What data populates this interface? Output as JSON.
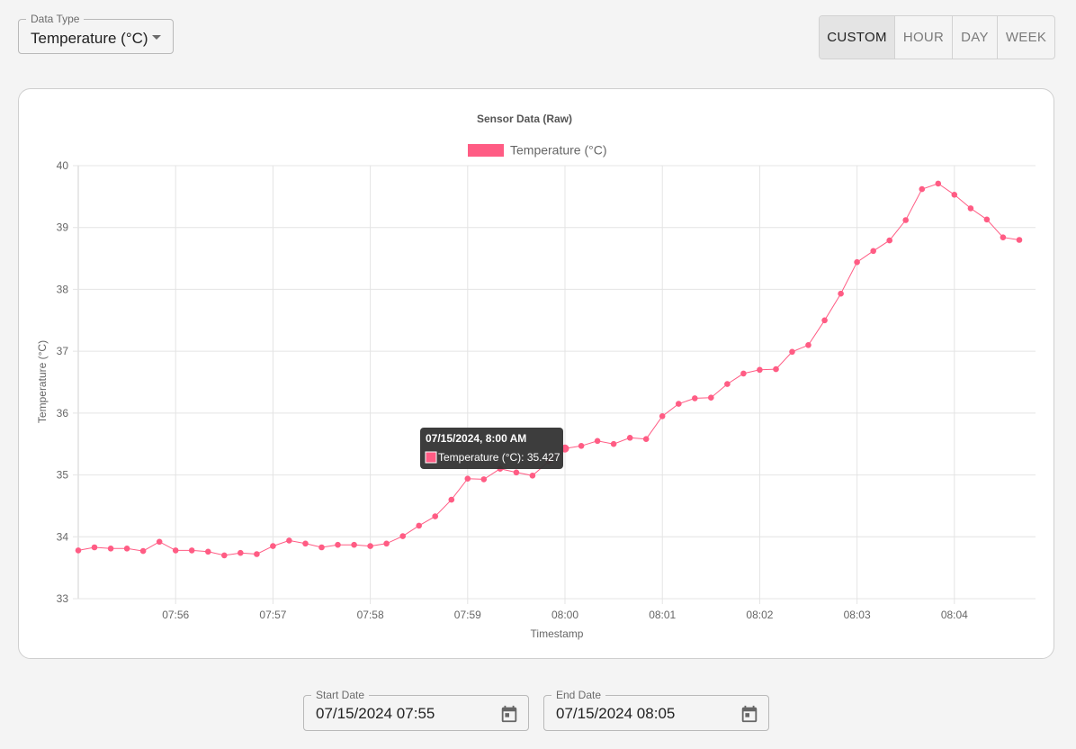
{
  "controls": {
    "data_type": {
      "label": "Data Type",
      "value": "Temperature (°C)"
    },
    "range_buttons": [
      {
        "label": "CUSTOM",
        "selected": true
      },
      {
        "label": "HOUR",
        "selected": false
      },
      {
        "label": "DAY",
        "selected": false
      },
      {
        "label": "WEEK",
        "selected": false
      }
    ],
    "start_date": {
      "label": "Start Date",
      "value": "07/15/2024 07:55"
    },
    "end_date": {
      "label": "End Date",
      "value": "07/15/2024 08:05"
    }
  },
  "colors": {
    "series": "#ff5c84",
    "grid": "#e4e4e4",
    "tooltip_bg": "#333333"
  },
  "tooltip": {
    "title": "07/15/2024, 8:00 AM",
    "text": "Temperature (°C): 35.427"
  },
  "chart_data": {
    "type": "line",
    "title": "Sensor Data (Raw)",
    "xlabel": "Timestamp",
    "ylabel": "Temperature (°C)",
    "legend": {
      "position": "top",
      "entries": [
        "Temperature (°C)"
      ]
    },
    "grid": true,
    "ylim": [
      33,
      40
    ],
    "y_ticks": [
      "33",
      "34",
      "35",
      "36",
      "37",
      "38",
      "39",
      "40"
    ],
    "x_ticks": [
      "07:56",
      "07:57",
      "07:58",
      "07:59",
      "08:00",
      "08:01",
      "08:02",
      "08:03",
      "08:04"
    ],
    "xlim": [
      "07:55:00",
      "08:04:50"
    ],
    "series": [
      {
        "name": "Temperature (°C)",
        "points": [
          [
            "07:55:00",
            33.78
          ],
          [
            "07:55:10",
            33.83
          ],
          [
            "07:55:20",
            33.81
          ],
          [
            "07:55:30",
            33.81
          ],
          [
            "07:55:40",
            33.77
          ],
          [
            "07:55:50",
            33.92
          ],
          [
            "07:56:00",
            33.78
          ],
          [
            "07:56:10",
            33.78
          ],
          [
            "07:56:20",
            33.76
          ],
          [
            "07:56:30",
            33.7
          ],
          [
            "07:56:40",
            33.74
          ],
          [
            "07:56:50",
            33.72
          ],
          [
            "07:57:00",
            33.85
          ],
          [
            "07:57:10",
            33.94
          ],
          [
            "07:57:20",
            33.89
          ],
          [
            "07:57:30",
            33.83
          ],
          [
            "07:57:40",
            33.87
          ],
          [
            "07:57:50",
            33.87
          ],
          [
            "07:58:00",
            33.85
          ],
          [
            "07:58:10",
            33.89
          ],
          [
            "07:58:20",
            34.01
          ],
          [
            "07:58:30",
            34.18
          ],
          [
            "07:58:40",
            34.33
          ],
          [
            "07:58:50",
            34.6
          ],
          [
            "07:59:00",
            34.94
          ],
          [
            "07:59:10",
            34.93
          ],
          [
            "07:59:20",
            35.1
          ],
          [
            "07:59:30",
            35.04
          ],
          [
            "07:59:40",
            34.99
          ],
          [
            "07:59:50",
            35.22
          ],
          [
            "08:00:00",
            35.427
          ],
          [
            "08:00:10",
            35.47
          ],
          [
            "08:00:20",
            35.55
          ],
          [
            "08:00:30",
            35.5
          ],
          [
            "08:00:40",
            35.6
          ],
          [
            "08:00:50",
            35.58
          ],
          [
            "08:01:00",
            35.95
          ],
          [
            "08:01:10",
            36.15
          ],
          [
            "08:01:20",
            36.24
          ],
          [
            "08:01:30",
            36.25
          ],
          [
            "08:01:40",
            36.47
          ],
          [
            "08:01:50",
            36.64
          ],
          [
            "08:02:00",
            36.7
          ],
          [
            "08:02:10",
            36.71
          ],
          [
            "08:02:20",
            36.99
          ],
          [
            "08:02:30",
            37.1
          ],
          [
            "08:02:40",
            37.5
          ],
          [
            "08:02:50",
            37.93
          ],
          [
            "08:03:00",
            38.44
          ],
          [
            "08:03:10",
            38.62
          ],
          [
            "08:03:20",
            38.79
          ],
          [
            "08:03:30",
            39.12
          ],
          [
            "08:03:40",
            39.62
          ],
          [
            "08:03:50",
            39.71
          ],
          [
            "08:04:00",
            39.53
          ],
          [
            "08:04:10",
            39.31
          ],
          [
            "08:04:20",
            39.13
          ],
          [
            "08:04:30",
            38.84
          ],
          [
            "08:04:40",
            38.8
          ]
        ]
      }
    ]
  }
}
